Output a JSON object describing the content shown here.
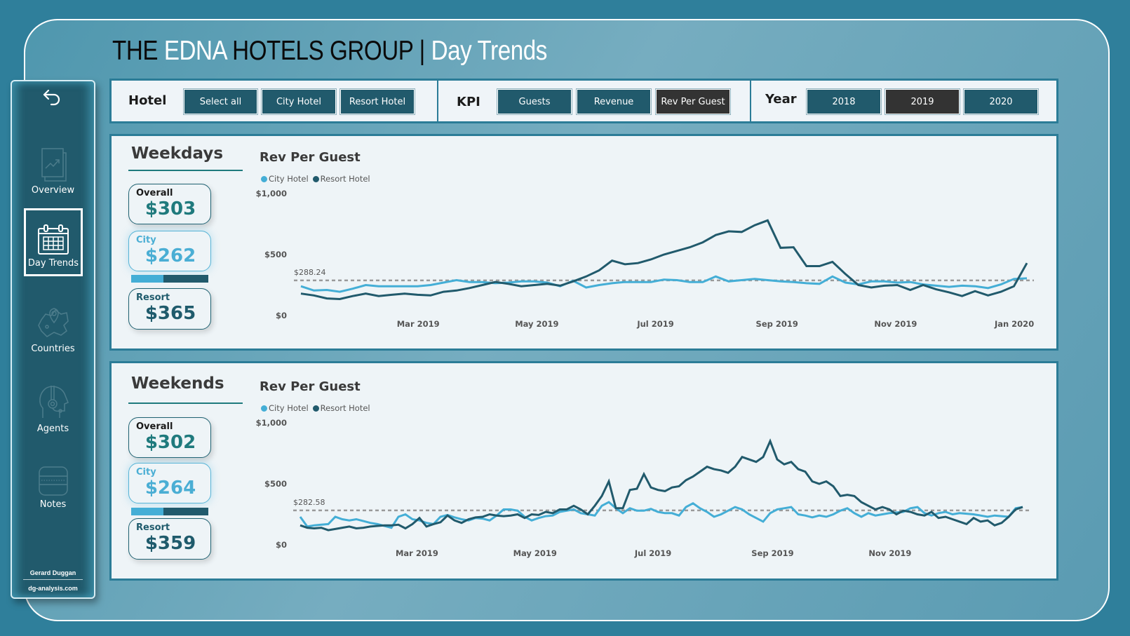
{
  "title": {
    "part1": "THE ",
    "part2": "EDNA",
    "part3": " HOTELS GROUP | ",
    "part4": "Day Trends"
  },
  "sidebar": {
    "back_icon": "undo-arrow-icon",
    "items": [
      {
        "label": "Overview",
        "icon": "report-chart-icon",
        "active": false
      },
      {
        "label": "Day Trends",
        "icon": "calendar-icon",
        "active": true
      },
      {
        "label": "Countries",
        "icon": "map-pin-icon",
        "active": false
      },
      {
        "label": "Agents",
        "icon": "headset-agent-icon",
        "active": false
      },
      {
        "label": "Notes",
        "icon": "notes-icon",
        "active": false
      }
    ],
    "author": "Gerard Duggan",
    "site": "dg-analysis.com"
  },
  "filters": {
    "hotel": {
      "label": "Hotel",
      "options": [
        "Select all",
        "City Hotel",
        "Resort Hotel"
      ],
      "selected": null
    },
    "kpi": {
      "label": "KPI",
      "options": [
        "Guests",
        "Revenue",
        "Rev Per Guest"
      ],
      "selected": "Rev Per Guest"
    },
    "year": {
      "label": "Year",
      "options": [
        "2018",
        "2019",
        "2020"
      ],
      "selected": "2019"
    }
  },
  "colors": {
    "city": "#44aed6",
    "resort": "#215a6c",
    "accent": "#2b7c97",
    "selected_button": "#333333"
  },
  "weekdays": {
    "title": "Weekdays",
    "kpis": {
      "overall": {
        "label": "Overall",
        "value": "$303"
      },
      "city": {
        "label": "City",
        "value": "$262"
      },
      "resort": {
        "label": "Resort",
        "value": "$365"
      }
    },
    "split_city_fraction": 0.42
  },
  "weekends": {
    "title": "Weekends",
    "kpis": {
      "overall": {
        "label": "Overall",
        "value": "$302"
      },
      "city": {
        "label": "City",
        "value": "$264"
      },
      "resort": {
        "label": "Resort",
        "value": "$359"
      }
    },
    "split_city_fraction": 0.42
  },
  "chart_data": [
    {
      "type": "line",
      "title": "Rev Per Guest",
      "panel": "Weekdays",
      "legend": [
        "City Hotel",
        "Resort Hotel"
      ],
      "legend_position": "top-left",
      "yticks": [
        "$0",
        "$500",
        "$1,000"
      ],
      "ylim": [
        0,
        1000
      ],
      "xticks": [
        "Mar 2019",
        "May 2019",
        "Jul 2019",
        "Sep 2019",
        "Nov 2019",
        "Jan 2020"
      ],
      "xtick_positions": [
        8.4,
        16.9,
        25.4,
        34.1,
        42.6,
        51.1
      ],
      "xlim": [
        0,
        52
      ],
      "reference_line": {
        "value": 288.24,
        "label": "$288.24"
      },
      "series": [
        {
          "name": "City Hotel",
          "values": [
            240,
            205,
            210,
            195,
            220,
            250,
            240,
            240,
            240,
            240,
            250,
            270,
            290,
            275,
            275,
            265,
            270,
            280,
            280,
            270,
            240,
            285,
            230,
            250,
            265,
            275,
            275,
            275,
            295,
            290,
            275,
            275,
            320,
            280,
            290,
            300,
            290,
            280,
            275,
            265,
            260,
            320,
            270,
            255,
            280,
            280,
            270,
            275,
            255,
            245,
            235,
            245,
            240,
            225,
            255,
            300,
            305
          ]
        },
        {
          "name": "Resort Hotel",
          "values": [
            180,
            165,
            140,
            135,
            160,
            180,
            160,
            170,
            180,
            170,
            165,
            195,
            205,
            225,
            250,
            275,
            260,
            240,
            250,
            260,
            245,
            280,
            320,
            370,
            450,
            420,
            430,
            460,
            500,
            530,
            560,
            600,
            660,
            690,
            685,
            740,
            780,
            555,
            560,
            405,
            405,
            440,
            340,
            250,
            230,
            245,
            250,
            210,
            250,
            215,
            190,
            160,
            200,
            165,
            195,
            240,
            430
          ]
        }
      ]
    },
    {
      "type": "line",
      "title": "Rev Per Guest",
      "panel": "Weekends",
      "legend": [
        "City Hotel",
        "Resort Hotel"
      ],
      "legend_position": "top-left",
      "yticks": [
        "$0",
        "$500",
        "$1,000"
      ],
      "ylim": [
        0,
        1000
      ],
      "xticks": [
        "Mar 2019",
        "May 2019",
        "Jul 2019",
        "Sep 2019",
        "Nov 2019"
      ],
      "xtick_positions": [
        16.8,
        33.8,
        50.8,
        68.0,
        84.9
      ],
      "xlim": [
        0,
        104
      ],
      "reference_line": {
        "value": 282.58,
        "label": "$282.58"
      },
      "series": [
        {
          "name": "City Hotel",
          "values": [
            230,
            150,
            160,
            165,
            170,
            230,
            210,
            200,
            210,
            195,
            180,
            170,
            155,
            140,
            230,
            250,
            210,
            200,
            180,
            170,
            230,
            245,
            225,
            210,
            200,
            220,
            215,
            200,
            240,
            290,
            290,
            280,
            230,
            200,
            220,
            235,
            240,
            270,
            280,
            290,
            260,
            250,
            240,
            320,
            350,
            300,
            260,
            300,
            280,
            280,
            295,
            270,
            260,
            260,
            240,
            310,
            340,
            300,
            270,
            230,
            250,
            280,
            310,
            290,
            250,
            220,
            190,
            260,
            290,
            300,
            310,
            250,
            240,
            225,
            240,
            230,
            250,
            280,
            300,
            260,
            230,
            260,
            240,
            250,
            260,
            265,
            270,
            300,
            310,
            260,
            240,
            260,
            270,
            250,
            260,
            255,
            250,
            240,
            230,
            240,
            235,
            230,
            300,
            310
          ]
        },
        {
          "name": "Resort Hotel",
          "values": [
            160,
            140,
            135,
            140,
            120,
            130,
            140,
            150,
            135,
            140,
            150,
            155,
            160,
            160,
            165,
            135,
            170,
            220,
            150,
            170,
            185,
            240,
            200,
            180,
            210,
            225,
            230,
            250,
            240,
            235,
            240,
            250,
            220,
            250,
            245,
            270,
            260,
            290,
            290,
            320,
            290,
            250,
            320,
            400,
            520,
            300,
            300,
            450,
            460,
            580,
            470,
            450,
            440,
            470,
            480,
            530,
            560,
            600,
            640,
            620,
            610,
            590,
            640,
            720,
            700,
            680,
            720,
            850,
            700,
            660,
            680,
            620,
            600,
            520,
            500,
            520,
            480,
            400,
            410,
            400,
            350,
            320,
            290,
            310,
            290,
            250,
            280,
            270,
            250,
            240,
            270,
            220,
            230,
            210,
            190,
            170,
            220,
            190,
            200,
            160,
            180,
            230,
            290,
            310
          ]
        }
      ]
    }
  ]
}
